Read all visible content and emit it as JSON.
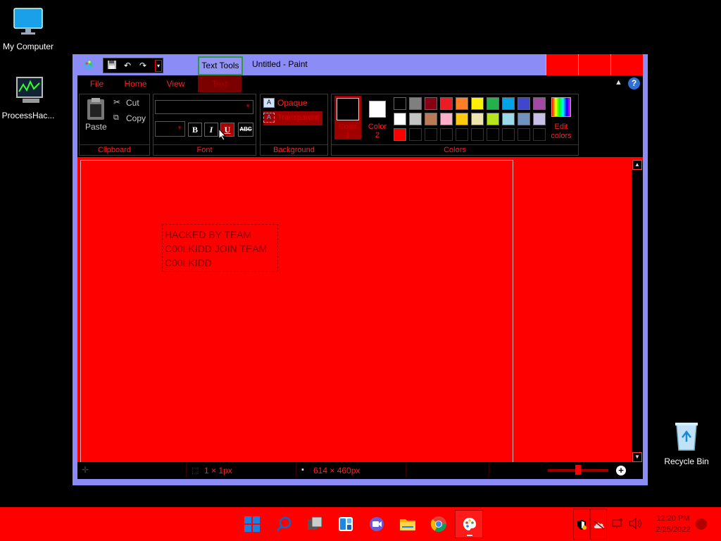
{
  "desktop": {
    "icons": [
      {
        "label": "My Computer",
        "icon": "monitor-icon"
      },
      {
        "label": "ProcessHac...",
        "icon": "process-hacker-icon"
      },
      {
        "label": "Recycle Bin",
        "icon": "recycle-bin-icon"
      }
    ]
  },
  "window": {
    "title": "Untitled - Paint",
    "context_tab": "Text Tools",
    "menu": [
      "File",
      "Home",
      "View",
      "Text"
    ]
  },
  "ribbon": {
    "clipboard": {
      "paste": "Paste",
      "cut": "Cut",
      "copy": "Copy",
      "label": "Clipboard"
    },
    "font": {
      "label": "Font",
      "font_name": "",
      "font_size": "",
      "bold": "B",
      "italic": "I",
      "underline": "U",
      "strikethrough": "ABC"
    },
    "background": {
      "opaque": "Opaque",
      "transparent": "Transparent",
      "label": "Background"
    },
    "colors": {
      "color1": "Color 1",
      "color2": "Color 2",
      "edit": "Edit colors",
      "label": "Colors",
      "color1_value": "#000000",
      "color2_value": "#ffffff",
      "palette_row1": [
        "#000000",
        "#7f7f7f",
        "#880015",
        "#ed1c24",
        "#ff7f27",
        "#fff200",
        "#22b14c",
        "#00a2e8",
        "#3f48cc",
        "#a349a4"
      ],
      "palette_row2": [
        "#ffffff",
        "#c3c3c3",
        "#b97a57",
        "#ffaec9",
        "#ffc90e",
        "#efe4b0",
        "#b5e61d",
        "#99d9ea",
        "#7092be",
        "#c8bfe7"
      ],
      "palette_row3": [
        "#ff0000",
        "#000000",
        "#000000",
        "#000000",
        "#000000",
        "#000000",
        "#000000",
        "#000000",
        "#000000",
        "#000000"
      ]
    }
  },
  "canvas": {
    "background_color": "#ff0000",
    "text_lines": [
      "HACKED BY TEAM",
      "C00LKIDD JOIN TEAM",
      "C00LKIDD"
    ]
  },
  "statusbar": {
    "selection_size": "1 × 1px",
    "image_size": "614 × 460px"
  },
  "taskbar": {
    "time": "12:20 PM",
    "date": "2/25/2022",
    "icons": [
      "start-icon",
      "search-icon",
      "task-view-icon",
      "widgets-icon",
      "chat-icon",
      "file-explorer-icon",
      "chrome-icon",
      "paint-icon"
    ]
  }
}
